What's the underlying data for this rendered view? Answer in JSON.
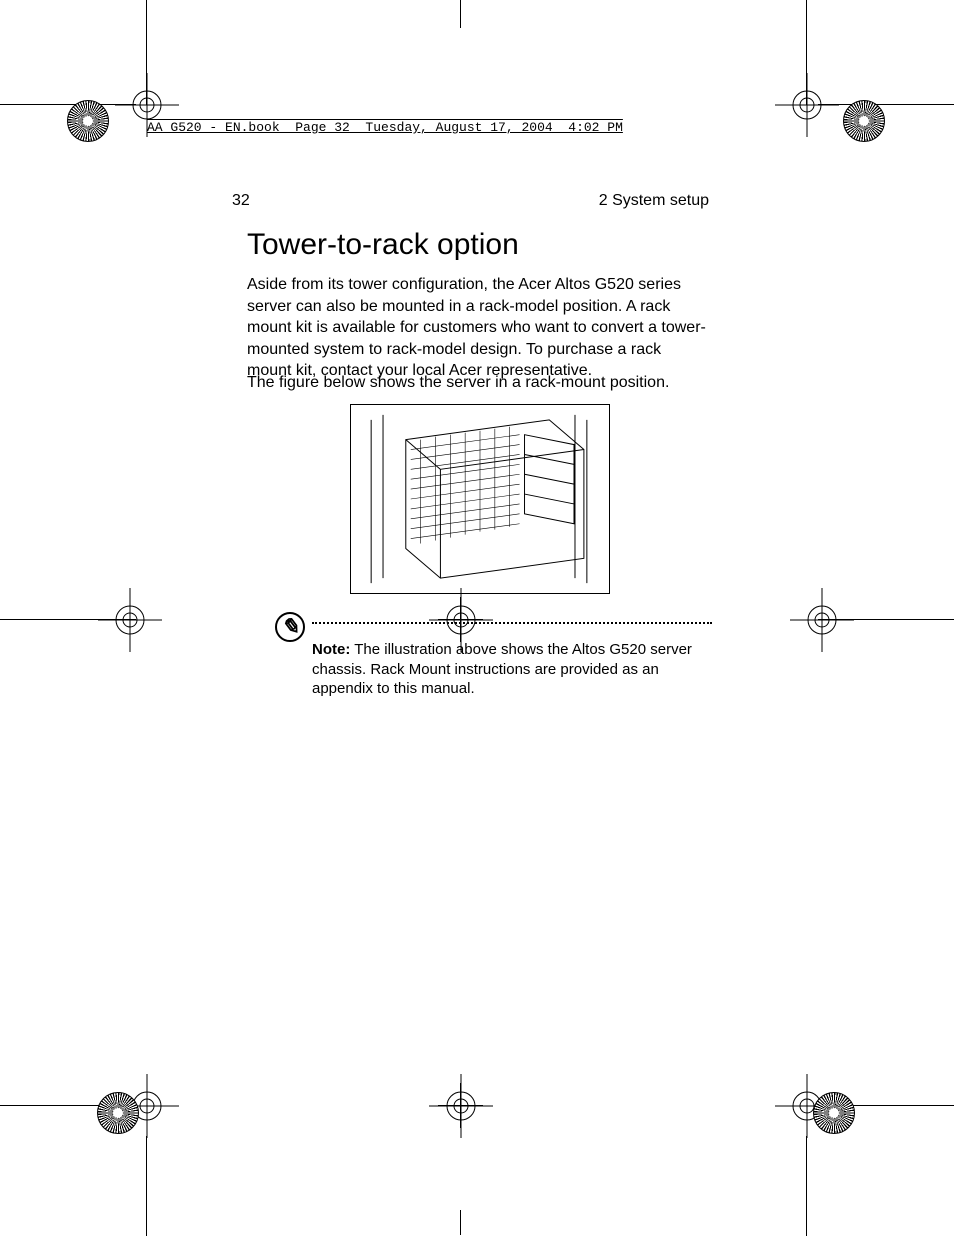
{
  "frame_header": "AA G520 - EN.book  Page 32  Tuesday, August 17, 2004  4:02 PM",
  "page_number": "32",
  "section_label": "2 System setup",
  "title": "Tower-to-rack option",
  "para1": "Aside from its tower configuration, the Acer Altos G520 series server can also be mounted in a rack-model position.  A rack mount kit is available for customers who want to convert a tower-mounted system to rack-model design.  To purchase a rack mount kit, contact your local Acer representative.",
  "para2": "The figure below shows the server in a rack-mount position.",
  "note_label": "Note:",
  "note_text": "  The illustration above shows the Altos G520 server chassis. Rack Mount instructions are provided as an appendix to this manual.",
  "figure_alt": "Isometric line drawing of the Altos G520 server chassis mounted horizontally in a rack"
}
